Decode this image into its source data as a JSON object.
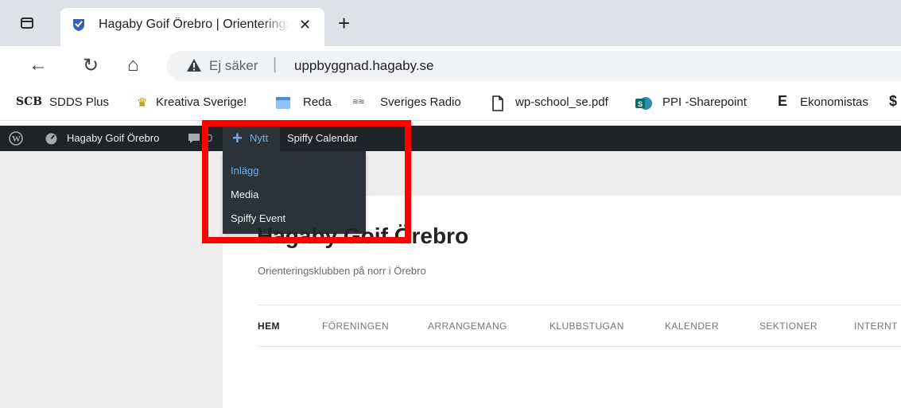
{
  "browser": {
    "tab": {
      "title": "Hagaby Goif Örebro | Orienteringsklubben på norr i Örebro",
      "close": "✕"
    },
    "new_tab": "+",
    "nav": {
      "back": "←",
      "reload": "↻",
      "home": "⌂"
    },
    "address": {
      "security_label": "Ej säker",
      "separator": "|",
      "url": "uppbyggnad.hagaby.se"
    },
    "bookmarks": [
      {
        "icon": "SCB",
        "label": "SDDS Plus"
      },
      {
        "icon": "crown",
        "label": "Kreativa Sverige!"
      },
      {
        "icon": "calendar",
        "label": "Reda"
      },
      {
        "icon": "SR",
        "label": "Sveriges Radio"
      },
      {
        "icon": "doc",
        "label": "wp-school_se.pdf"
      },
      {
        "icon": "sharepoint",
        "label": "PPI -Sharepoint"
      },
      {
        "icon": "E",
        "label": "Ekonomistas"
      }
    ]
  },
  "admin_bar": {
    "site_name": "Hagaby Goif Örebro",
    "comments_count": "0",
    "new_label": "Nytt",
    "spiffy_calendar": "Spiffy Calendar",
    "new_menu": [
      {
        "label": "Inlägg",
        "active": true
      },
      {
        "label": "Media",
        "active": false
      },
      {
        "label": "Spiffy Event",
        "active": false
      }
    ]
  },
  "site": {
    "title": "Hagaby Goif Örebro",
    "tagline": "Orienteringsklubben på norr i Örebro",
    "menu": [
      "HEM",
      "FÖRENINGEN",
      "ARRANGEMANG",
      "KLUBBSTUGAN",
      "KALENDER",
      "SEKTIONER",
      "INTERNT"
    ]
  },
  "colors": {
    "admin_bar_bg": "#1d2327",
    "admin_accent": "#72aee6",
    "highlight": "#ff0000"
  }
}
